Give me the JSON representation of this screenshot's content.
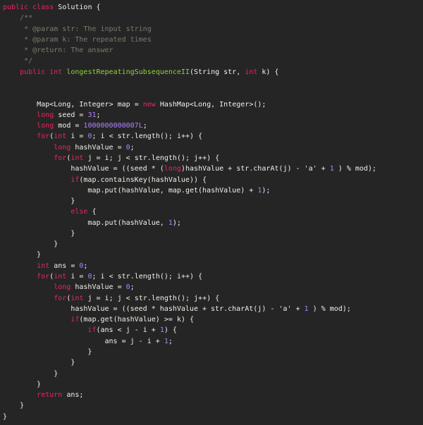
{
  "colors": {
    "background": "#252525",
    "text": "#f1f1ea",
    "keyword": "#e8265e",
    "function": "#8dd43c",
    "number": "#ae81ff",
    "comment": "#7a7a6e"
  },
  "function_name": "longestRepeatingSubsequenceII",
  "keywords": [
    "public",
    "class",
    "int",
    "long",
    "new",
    "for",
    "if",
    "else",
    "return"
  ],
  "code_lines": [
    "public class Solution {",
    "    /**",
    "     * @param str: The input string",
    "     * @param k: The repeated times",
    "     * @return: The answer",
    "     */",
    "    public int longestRepeatingSubsequenceII(String str, int k) {",
    "",
    "",
    "        Map<Long, Integer> map = new HashMap<Long, Integer>();",
    "        long seed = 31;",
    "        long mod = 1000000000007L;",
    "        for(int i = 0; i < str.length(); i++) {",
    "            long hashValue = 0;",
    "            for(int j = i; j < str.length(); j++) {",
    "                hashValue = ((seed * (long)hashValue + str.charAt(j) - 'a' + 1 ) % mod);",
    "                if(map.containsKey(hashValue)) {",
    "                    map.put(hashValue, map.get(hashValue) + 1);",
    "                }",
    "                else {",
    "                    map.put(hashValue, 1);",
    "                }",
    "            }",
    "        }",
    "        int ans = 0;",
    "        for(int i = 0; i < str.length(); i++) {",
    "            long hashValue = 0;",
    "            for(int j = i; j < str.length(); j++) {",
    "                hashValue = ((seed * hashValue + str.charAt(j) - 'a' + 1 ) % mod);",
    "                if(map.get(hashValue) >= k) {",
    "                    if(ans < j - i + 1) {",
    "                        ans = j - i + 1;",
    "                    }",
    "                }",
    "            }",
    "        }",
    "        return ans;",
    "    }",
    "}"
  ]
}
